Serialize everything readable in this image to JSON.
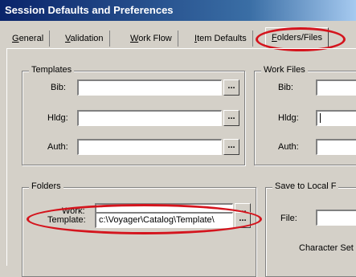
{
  "window": {
    "title": "Session Defaults and Preferences"
  },
  "tabs": [
    {
      "label": "General",
      "underline": "G",
      "rest": "eneral"
    },
    {
      "label": "Validation",
      "underline": "V",
      "rest": "alidation"
    },
    {
      "label": "Work Flow",
      "underline": "W",
      "rest": "ork Flow"
    },
    {
      "label": "Item Defaults",
      "underline": "I",
      "rest": "tem Defaults"
    },
    {
      "label": "Folders/Files",
      "underline": "F",
      "rest": "olders/Files",
      "active": true
    }
  ],
  "templates": {
    "title": "Templates",
    "bib_label": "Bib:",
    "hldg_label": "Hldg:",
    "auth_label": "Auth:",
    "bib_value": "",
    "hldg_value": "",
    "auth_value": ""
  },
  "work_files": {
    "title": "Work Files",
    "bib_label": "Bib:",
    "hldg_label": "Hldg:",
    "auth_label": "Auth:"
  },
  "folders": {
    "title": "Folders",
    "work_label": "Work:",
    "template_label": "Template:",
    "work_value": "",
    "template_value": "c:\\Voyager\\Catalog\\Template\\"
  },
  "save_local": {
    "title": "Save to Local F",
    "file_label": "File:",
    "charset_label": "Character Set"
  },
  "browse_label": "...",
  "highlight_color": "#d4141d"
}
